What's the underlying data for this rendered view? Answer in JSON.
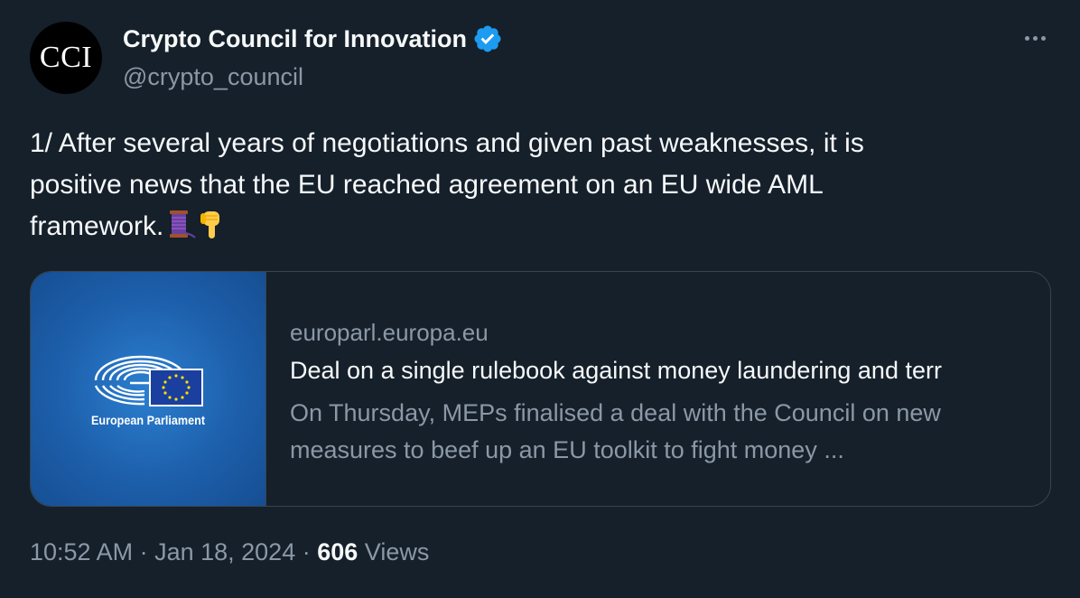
{
  "author": {
    "avatar_text": "CCI",
    "display_name": "Crypto Council for Innovation",
    "handle": "@crypto_council",
    "verified": true,
    "verified_color": "#1d9bf0"
  },
  "tweet": {
    "text_line1": "1/ After several years of negotiations and given past weaknesses, it is",
    "text_line2": "positive news that the EU reached agreement on an EU wide AML",
    "text_line3": "framework.",
    "emojis": [
      "thread-spool-emoji",
      "backhand-index-pointing-down-emoji"
    ]
  },
  "card": {
    "image_label": "European Parliament",
    "domain": "europarl.europa.eu",
    "title": "Deal on a single rulebook against money laundering and terr",
    "description_line1": "On Thursday, MEPs finalised a deal with the Council on new",
    "description_line2": "measures to beef up an EU toolkit to fight money ..."
  },
  "meta": {
    "time": "10:52 AM",
    "separator": " · ",
    "date": "Jan 18, 2024",
    "views_count": "606",
    "views_label": "Views"
  },
  "colors": {
    "background": "#15202b",
    "text_primary": "#f7f9f9",
    "text_secondary": "#8b98a5",
    "border": "#38444d",
    "card_image_blue": "#1d5fab"
  }
}
